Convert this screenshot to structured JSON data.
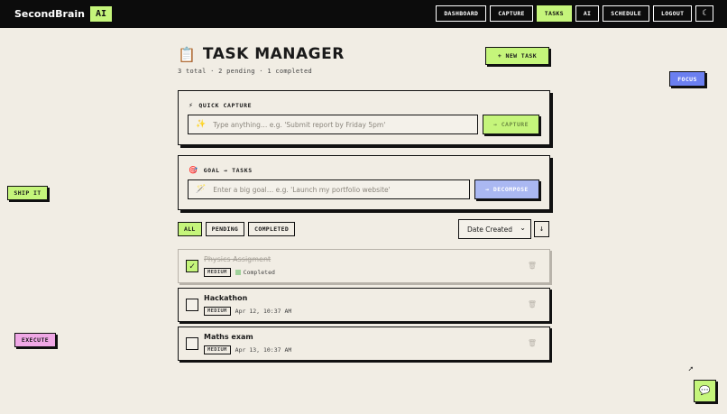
{
  "brand": {
    "name": "SecondBrain",
    "badge": "AI"
  },
  "nav": {
    "links": [
      "DASHBOARD",
      "CAPTURE",
      "TASKS",
      "AI",
      "SCHEDULE",
      "LOGOUT"
    ],
    "active": "TASKS",
    "theme_icon": "moon-icon",
    "theme_glyph": "☾"
  },
  "header": {
    "icon": "clipboard-icon",
    "icon_glyph": "📋",
    "title": "TASK MANAGER",
    "subtitle": "3 total · 2 pending · 1 completed",
    "new_task_label": "+ NEW TASK"
  },
  "quick_capture": {
    "icon": "sparkle-icon",
    "icon_glyph": "⚡",
    "title": "QUICK CAPTURE",
    "input_icon": "sparkles-icon",
    "input_glyph": "✨",
    "placeholder": "Type anything… e.g. 'Submit report by Friday 5pm'",
    "button_label": "→ CAPTURE",
    "button_color": "#c5f57b"
  },
  "goal": {
    "icon": "target-icon",
    "icon_glyph": "🎯",
    "title": "GOAL → TASKS",
    "input_icon": "magic-wand-icon",
    "input_glyph": "🪄",
    "placeholder": "Enter a big goal… e.g. 'Launch my portfolio website'",
    "button_label": "→ DECOMPOSE",
    "button_color": "#aab8f2"
  },
  "filters": {
    "options": [
      "ALL",
      "PENDING",
      "COMPLETED"
    ],
    "active": "ALL"
  },
  "sort": {
    "selected": "Date Created",
    "direction_glyph": "↓"
  },
  "tasks": [
    {
      "title": "Physics Assigment",
      "priority": "MEDIUM",
      "status": "Completed",
      "completed": true,
      "check_glyph": "✓"
    },
    {
      "title": "Hackathon",
      "priority": "MEDIUM",
      "date": "Apr 12, 10:37 AM",
      "completed": false,
      "check_glyph": ""
    },
    {
      "title": "Maths exam",
      "priority": "MEDIUM",
      "date": "Apr 13, 10:37 AM",
      "completed": false,
      "check_glyph": ""
    }
  ],
  "stickers": {
    "focus": {
      "label": "FOCUS",
      "color": "#6b7ff0"
    },
    "ship": {
      "label": "SHIP IT",
      "color": "#c5f57b"
    },
    "execute": {
      "label": "EXECUTE",
      "color": "#f0a8e6"
    }
  },
  "chat_button": {
    "icon": "chat-icon",
    "glyph": "💬"
  },
  "trash_glyph": "🗑",
  "cursor_glyph": "➚"
}
